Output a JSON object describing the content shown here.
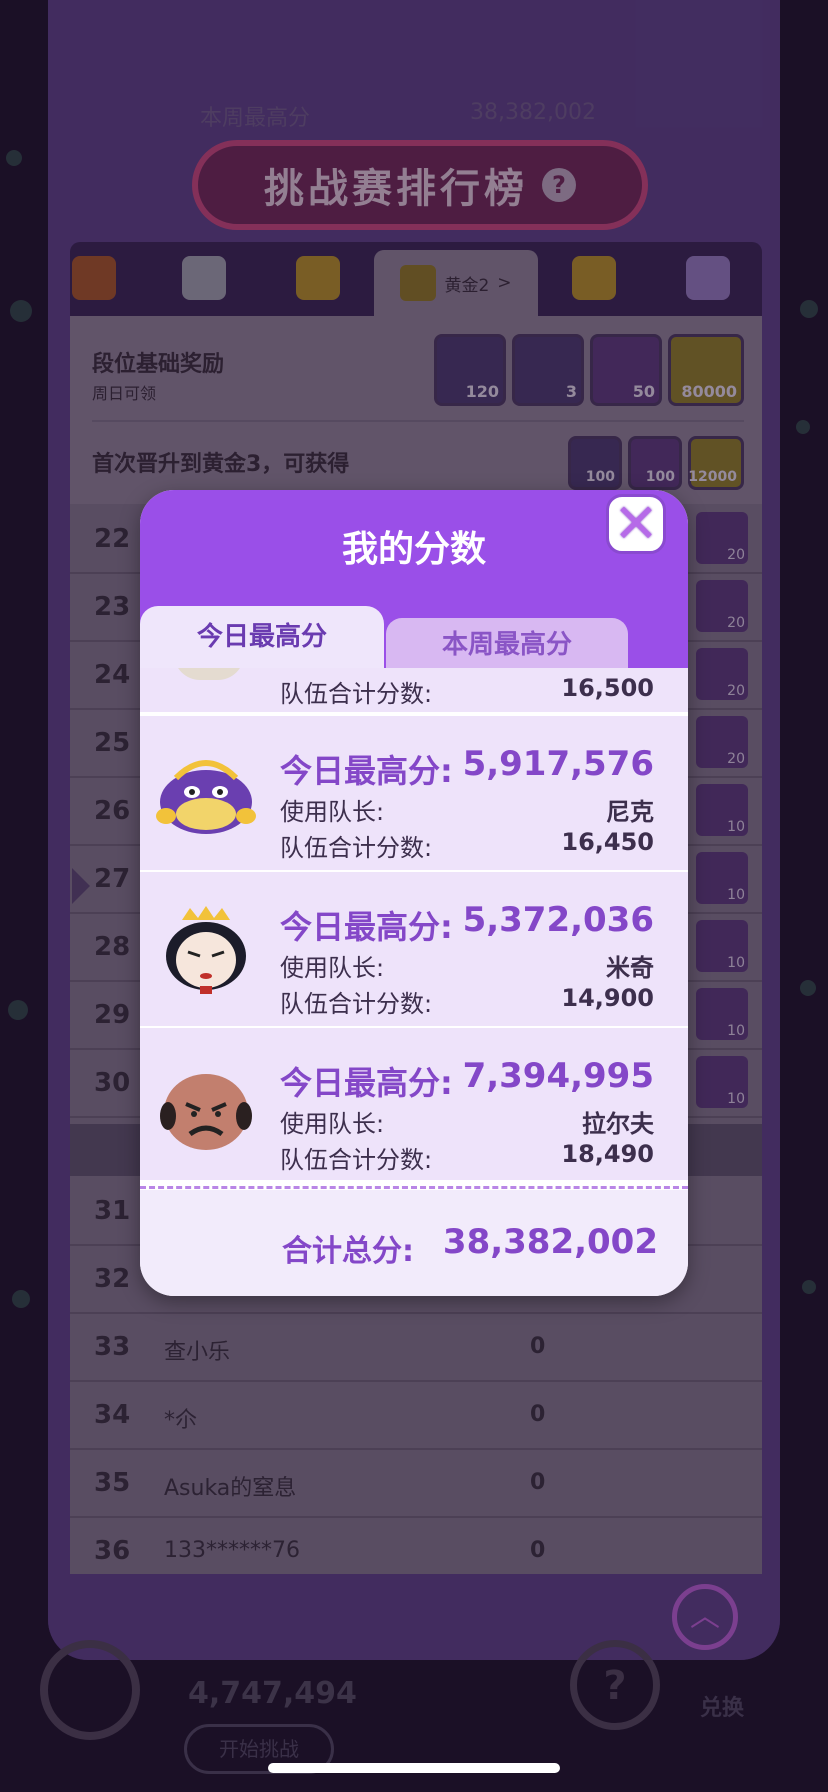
{
  "header": {
    "faint_left": "本周最高分",
    "faint_right": "38,382,002",
    "title": "挑战赛排行榜",
    "help_glyph": "?"
  },
  "tiers": {
    "active_label": "黄金2",
    "active_arrow": ">",
    "colors": [
      "#a0542a",
      "#9a9aa8",
      "#b08a2a",
      "#b08a2a",
      "#b08a2a",
      "#8f77b8"
    ]
  },
  "rewards": {
    "base_title": "段位基础奖励",
    "base_sub": "周日可领",
    "base_items": [
      "120",
      "3",
      "50",
      "80000"
    ],
    "promo_title": "首次晋升到黄金3，可获得",
    "promo_items": [
      "100",
      "100",
      "12000"
    ]
  },
  "ranks": [
    {
      "num": "22",
      "name": "",
      "score": "",
      "reward": "20"
    },
    {
      "num": "23",
      "name": "",
      "score": "",
      "reward": "20"
    },
    {
      "num": "24",
      "name": "",
      "score": "",
      "reward": "20"
    },
    {
      "num": "25",
      "name": "",
      "score": "",
      "reward": "20"
    },
    {
      "num": "26",
      "name": "",
      "score": "",
      "reward": "10"
    },
    {
      "num": "27",
      "name": "",
      "score": "",
      "reward": "10"
    },
    {
      "num": "28",
      "name": "",
      "score": "",
      "reward": "10"
    },
    {
      "num": "29",
      "name": "",
      "score": "",
      "reward": "10"
    },
    {
      "num": "30",
      "name": "",
      "score": "",
      "reward": "10"
    },
    {
      "num": "31",
      "name": "",
      "score": "",
      "reward": ""
    },
    {
      "num": "32",
      "name": "",
      "score": "",
      "reward": ""
    },
    {
      "num": "33",
      "name": "查小乐",
      "score": "0",
      "reward": ""
    },
    {
      "num": "34",
      "name": "*尒",
      "score": "0",
      "reward": ""
    },
    {
      "num": "35",
      "name": "Asuka的窒息",
      "score": "0",
      "reward": ""
    },
    {
      "num": "36",
      "name": "133******76",
      "score": "0",
      "reward": ""
    }
  ],
  "bottom": {
    "score": "4,747,494",
    "button": "开始挑战",
    "help_glyph": "?",
    "exchange": "兑换",
    "scroll_top_glyph": "︿"
  },
  "modal": {
    "title": "我的分数",
    "close_glyph": "✕",
    "tab_today": "今日最高分",
    "tab_week": "本周最高分",
    "partial_row": {
      "label": "队伍合计分数:",
      "value": "16,500"
    },
    "entries": [
      {
        "big_label": "今日最高分:",
        "big_value": "5,917,576",
        "leader_label": "使用队长:",
        "leader": "尼克",
        "team_label": "队伍合计分数:",
        "team_score": "16,450",
        "avatar": "nick-avatar-icon"
      },
      {
        "big_label": "今日最高分:",
        "big_value": "5,372,036",
        "leader_label": "使用队长:",
        "leader": "米奇",
        "team_label": "队伍合计分数:",
        "team_score": "14,900",
        "avatar": "queen-avatar-icon"
      },
      {
        "big_label": "今日最高分:",
        "big_value": "7,394,995",
        "leader_label": "使用队长:",
        "leader": "拉尔夫",
        "team_label": "队伍合计分数:",
        "team_score": "18,490",
        "avatar": "bald-villain-avatar-icon"
      }
    ],
    "total_label": "合计总分:",
    "total_value": "38,382,002"
  }
}
